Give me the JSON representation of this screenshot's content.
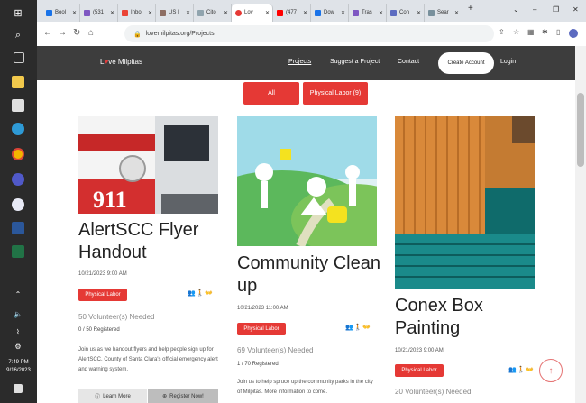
{
  "taskbar": {
    "time": "7:49 PM",
    "date": "9/16/2023"
  },
  "browser": {
    "tabs": [
      "Bool",
      "(531",
      "Inbo",
      "US I",
      "Cito",
      "Lov",
      "(477",
      "Dow",
      "Tras",
      "Con",
      "Sear"
    ],
    "url": "lovemilpitas.org/Projects"
  },
  "site": {
    "logo_pre": "L",
    "logo_heart": "♥",
    "logo_post": "ve Milpitas",
    "nav": {
      "projects": "Projects",
      "suggest": "Suggest a Project",
      "contact": "Contact",
      "create": "Create Account",
      "login": "Login"
    }
  },
  "filters": {
    "all": "All",
    "physical": "Physical Labor (9)"
  },
  "cards": [
    {
      "title": "AlertSCC Flyer Handout",
      "date": "10/21/2023 9:00 AM",
      "badge": "Physical Labor",
      "volunteers": "50 Volunteer(s) Needed",
      "registered": "0 / 50 Registered",
      "description": "Join us as we handout flyers and help people sign up for AlertSCC.  County of Santa Clara's official emergency alert and warning system.",
      "learn_more": "Learn More",
      "register": "Register Now!"
    },
    {
      "title": "Community Clean up",
      "date": "10/21/2023 11:00 AM",
      "badge": "Physical Labor",
      "volunteers": "69 Volunteer(s) Needed",
      "registered": "1 / 70 Registered",
      "description": "Join us to help spruce up the community parks in the city of Milpitas.  More information to come."
    },
    {
      "title": "Conex Box Painting",
      "date": "10/21/2023 9:00 AM",
      "badge": "Physical Labor",
      "volunteers": "20 Volunteer(s) Needed"
    }
  ],
  "icons": {
    "people": "👥🚶👐"
  },
  "image_text": {
    "truck": "911"
  }
}
